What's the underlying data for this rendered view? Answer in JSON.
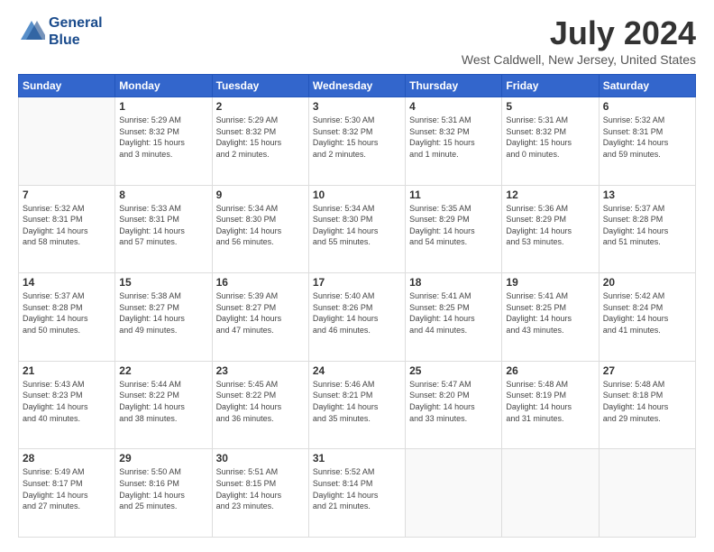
{
  "header": {
    "logo_line1": "General",
    "logo_line2": "Blue",
    "month_title": "July 2024",
    "location": "West Caldwell, New Jersey, United States"
  },
  "days_of_week": [
    "Sunday",
    "Monday",
    "Tuesday",
    "Wednesday",
    "Thursday",
    "Friday",
    "Saturday"
  ],
  "weeks": [
    [
      {
        "day": "",
        "info": ""
      },
      {
        "day": "1",
        "info": "Sunrise: 5:29 AM\nSunset: 8:32 PM\nDaylight: 15 hours\nand 3 minutes."
      },
      {
        "day": "2",
        "info": "Sunrise: 5:29 AM\nSunset: 8:32 PM\nDaylight: 15 hours\nand 2 minutes."
      },
      {
        "day": "3",
        "info": "Sunrise: 5:30 AM\nSunset: 8:32 PM\nDaylight: 15 hours\nand 2 minutes."
      },
      {
        "day": "4",
        "info": "Sunrise: 5:31 AM\nSunset: 8:32 PM\nDaylight: 15 hours\nand 1 minute."
      },
      {
        "day": "5",
        "info": "Sunrise: 5:31 AM\nSunset: 8:32 PM\nDaylight: 15 hours\nand 0 minutes."
      },
      {
        "day": "6",
        "info": "Sunrise: 5:32 AM\nSunset: 8:31 PM\nDaylight: 14 hours\nand 59 minutes."
      }
    ],
    [
      {
        "day": "7",
        "info": "Sunrise: 5:32 AM\nSunset: 8:31 PM\nDaylight: 14 hours\nand 58 minutes."
      },
      {
        "day": "8",
        "info": "Sunrise: 5:33 AM\nSunset: 8:31 PM\nDaylight: 14 hours\nand 57 minutes."
      },
      {
        "day": "9",
        "info": "Sunrise: 5:34 AM\nSunset: 8:30 PM\nDaylight: 14 hours\nand 56 minutes."
      },
      {
        "day": "10",
        "info": "Sunrise: 5:34 AM\nSunset: 8:30 PM\nDaylight: 14 hours\nand 55 minutes."
      },
      {
        "day": "11",
        "info": "Sunrise: 5:35 AM\nSunset: 8:29 PM\nDaylight: 14 hours\nand 54 minutes."
      },
      {
        "day": "12",
        "info": "Sunrise: 5:36 AM\nSunset: 8:29 PM\nDaylight: 14 hours\nand 53 minutes."
      },
      {
        "day": "13",
        "info": "Sunrise: 5:37 AM\nSunset: 8:28 PM\nDaylight: 14 hours\nand 51 minutes."
      }
    ],
    [
      {
        "day": "14",
        "info": "Sunrise: 5:37 AM\nSunset: 8:28 PM\nDaylight: 14 hours\nand 50 minutes."
      },
      {
        "day": "15",
        "info": "Sunrise: 5:38 AM\nSunset: 8:27 PM\nDaylight: 14 hours\nand 49 minutes."
      },
      {
        "day": "16",
        "info": "Sunrise: 5:39 AM\nSunset: 8:27 PM\nDaylight: 14 hours\nand 47 minutes."
      },
      {
        "day": "17",
        "info": "Sunrise: 5:40 AM\nSunset: 8:26 PM\nDaylight: 14 hours\nand 46 minutes."
      },
      {
        "day": "18",
        "info": "Sunrise: 5:41 AM\nSunset: 8:25 PM\nDaylight: 14 hours\nand 44 minutes."
      },
      {
        "day": "19",
        "info": "Sunrise: 5:41 AM\nSunset: 8:25 PM\nDaylight: 14 hours\nand 43 minutes."
      },
      {
        "day": "20",
        "info": "Sunrise: 5:42 AM\nSunset: 8:24 PM\nDaylight: 14 hours\nand 41 minutes."
      }
    ],
    [
      {
        "day": "21",
        "info": "Sunrise: 5:43 AM\nSunset: 8:23 PM\nDaylight: 14 hours\nand 40 minutes."
      },
      {
        "day": "22",
        "info": "Sunrise: 5:44 AM\nSunset: 8:22 PM\nDaylight: 14 hours\nand 38 minutes."
      },
      {
        "day": "23",
        "info": "Sunrise: 5:45 AM\nSunset: 8:22 PM\nDaylight: 14 hours\nand 36 minutes."
      },
      {
        "day": "24",
        "info": "Sunrise: 5:46 AM\nSunset: 8:21 PM\nDaylight: 14 hours\nand 35 minutes."
      },
      {
        "day": "25",
        "info": "Sunrise: 5:47 AM\nSunset: 8:20 PM\nDaylight: 14 hours\nand 33 minutes."
      },
      {
        "day": "26",
        "info": "Sunrise: 5:48 AM\nSunset: 8:19 PM\nDaylight: 14 hours\nand 31 minutes."
      },
      {
        "day": "27",
        "info": "Sunrise: 5:48 AM\nSunset: 8:18 PM\nDaylight: 14 hours\nand 29 minutes."
      }
    ],
    [
      {
        "day": "28",
        "info": "Sunrise: 5:49 AM\nSunset: 8:17 PM\nDaylight: 14 hours\nand 27 minutes."
      },
      {
        "day": "29",
        "info": "Sunrise: 5:50 AM\nSunset: 8:16 PM\nDaylight: 14 hours\nand 25 minutes."
      },
      {
        "day": "30",
        "info": "Sunrise: 5:51 AM\nSunset: 8:15 PM\nDaylight: 14 hours\nand 23 minutes."
      },
      {
        "day": "31",
        "info": "Sunrise: 5:52 AM\nSunset: 8:14 PM\nDaylight: 14 hours\nand 21 minutes."
      },
      {
        "day": "",
        "info": ""
      },
      {
        "day": "",
        "info": ""
      },
      {
        "day": "",
        "info": ""
      }
    ]
  ]
}
